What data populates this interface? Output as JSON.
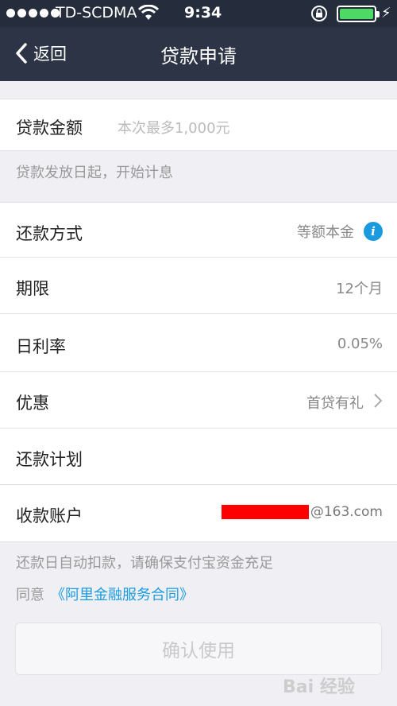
{
  "status": {
    "carrier": "TD-SCDMA",
    "time": "9:34",
    "battery_color": "#4cd964"
  },
  "nav": {
    "back_label": "返回",
    "title": "贷款申请"
  },
  "amount": {
    "label": "贷款金额",
    "placeholder": "本次最多1,000元",
    "note": "贷款发放日起，开始计息"
  },
  "rows": {
    "repay_method": {
      "label": "还款方式",
      "value": "等额本金"
    },
    "term": {
      "label": "期限",
      "value": "12个月"
    },
    "daily_rate": {
      "label": "日利率",
      "value": "0.05%"
    },
    "discount": {
      "label": "优惠",
      "value": "首贷有礼"
    },
    "repay_plan": {
      "label": "还款计划"
    },
    "account": {
      "label": "收款账户",
      "suffix": "@163.com"
    }
  },
  "footer": {
    "auto_debit_note": "还款日自动扣款，请确保支付宝资金充足",
    "agree_prefix": "同意",
    "agreement_link": "《阿里金融服务合同》",
    "confirm_label": "确认使用"
  },
  "watermark": "Bai 经验",
  "colors": {
    "nav_bg": "#2d3446",
    "link": "#1a9be0",
    "info_icon": "#1a9be0",
    "mask": "#ff0000"
  }
}
